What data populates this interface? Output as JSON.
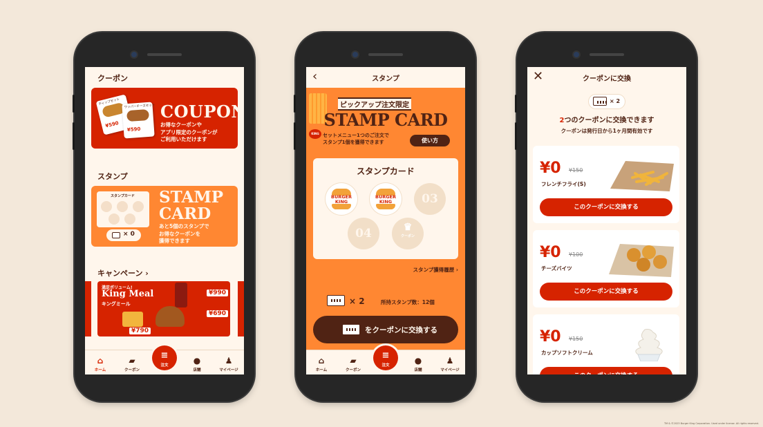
{
  "phone_home": {
    "coupon_section_title": "クーポン",
    "coupon_banner_title": "COUPON",
    "coupon_banner_desc_1": "お得なクーポンや",
    "coupon_banner_desc_2": "アプリ限定のクーポンが",
    "coupon_banner_desc_3": "ご利用いただけます",
    "coupon_card_1_label": "ディップセット",
    "coupon_card_1_price": "¥590",
    "coupon_card_2_label": "ワッパーチーズセット",
    "coupon_card_2_price": "¥590",
    "stamp_section_title": "スタンプ",
    "stamp_mini_title": "スタンプカード",
    "stamp_count": "× 0",
    "stamp_banner_title_1": "STAMP",
    "stamp_banner_title_2": "CARD",
    "stamp_banner_desc_1": "あと5個のスタンプで",
    "stamp_banner_desc_2": "お得なクーポンを",
    "stamp_banner_desc_3": "獲得できます",
    "campaign_section_title": "キャンペーン ›",
    "campaign_small": "満足ボリューム!",
    "campaign_big": "King Meal",
    "campaign_sub": "キングミール",
    "campaign_price_1": "¥990",
    "campaign_price_2": "¥690",
    "campaign_price_3": "¥790"
  },
  "phone_stamp": {
    "header_title": "スタンプ",
    "pickup_label": "ピックアップ注文限定",
    "card_big_title": "STAMP CARD",
    "info_1": "セットメニュー1つのご注文で",
    "info_2": "スタンプ1個を獲得できます",
    "howto_button": "使い方",
    "card_title": "スタンプカード",
    "slot_3": "03",
    "slot_4": "04",
    "slot_5_label": "クーポン",
    "history_link": "スタンプ獲得履歴 ›",
    "ticket_count": "× 2",
    "holding_label": "所持スタンプ数：12個",
    "exchange_button": "をクーポンに交換する"
  },
  "phone_exchange": {
    "header_title": "クーポンに交換",
    "chip_count": "× 2",
    "headline_num": "2",
    "headline_rest": "つのクーポンに交換できます",
    "subline": "クーポンは発行日から1ヶ月間有効です",
    "items": [
      {
        "price": "¥0",
        "old_price": "¥150",
        "name": "フレンチフライ(S)",
        "button": "このクーポンに交換する"
      },
      {
        "price": "¥0",
        "old_price": "¥100",
        "name": "チーズバイツ",
        "button": "このクーポンに交換する"
      },
      {
        "price": "¥0",
        "old_price": "¥150",
        "name": "カップソフトクリーム",
        "button": "このクーポンに交換する"
      }
    ]
  },
  "tabbar": {
    "home": "ホーム",
    "coupon": "クーポン",
    "order": "注文",
    "store": "店舗",
    "mypage": "マイページ"
  },
  "logo": {
    "line1": "BURGER",
    "line2": "KING"
  },
  "footnote": "TM & ©2023 Burger King Corporation. Used under license. All rights reserved.",
  "colors": {
    "brand_red": "#d62300",
    "brand_orange": "#ff8732",
    "brand_brown": "#502314",
    "cream": "#fff6ec"
  },
  "icons": [
    "home-icon",
    "coupon-tab-icon",
    "burger-icon",
    "location-pin-icon",
    "user-icon",
    "back-chevron-icon",
    "close-icon",
    "crown-icon",
    "ticket-icon"
  ]
}
